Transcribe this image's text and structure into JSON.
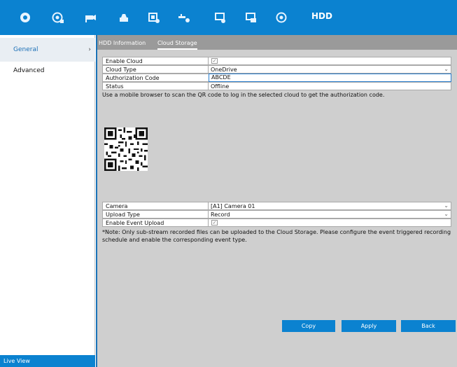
{
  "topbar": {
    "title": "HDD",
    "icons": [
      "live-view-icon",
      "playback-icon",
      "camera-icon",
      "record-icon",
      "storage-icon",
      "network-icon",
      "system-icon",
      "maintenance-icon",
      "shutdown-icon"
    ]
  },
  "sidebar": {
    "items": [
      {
        "label": "General"
      },
      {
        "label": "Advanced"
      }
    ],
    "live_view": "Live View"
  },
  "tabs": [
    "HDD Information",
    "Cloud Storage"
  ],
  "cloud": {
    "enable_cloud_label": "Enable Cloud",
    "enable_cloud_checked": true,
    "cloud_type_label": "Cloud Type",
    "cloud_type_value": "OneDrive",
    "auth_code_label": "Authorization Code",
    "auth_code_value": "ABCDE",
    "status_label": "Status",
    "status_value": "Offline",
    "qr_instruction": "Use a mobile browser to scan the QR code to log in the selected cloud to get the authorization code.",
    "camera_label": "Camera",
    "camera_value": "[A1] Camera 01",
    "upload_type_label": "Upload Type",
    "upload_type_value": "Record",
    "event_upload_label": "Enable Event Upload",
    "event_upload_checked": true,
    "note": "*Note: Only sub-stream recorded files can be uploaded to the Cloud Storage. Please configure the event triggered recording schedule and enable the corresponding event type."
  },
  "buttons": {
    "copy": "Copy",
    "apply": "Apply",
    "back": "Back"
  },
  "colors": {
    "accent": "#0b82d0",
    "panel": "#cfcfcf"
  }
}
